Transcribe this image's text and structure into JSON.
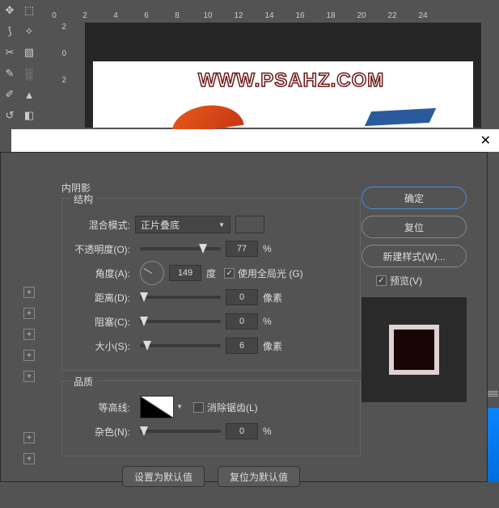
{
  "ruler_top": [
    "0",
    "2",
    "4",
    "6",
    "8",
    "10",
    "12",
    "14",
    "16",
    "18",
    "20",
    "22",
    "24"
  ],
  "ruler_left": [
    "2",
    "0",
    "2"
  ],
  "watermark": "WWW.PSAHZ.COM",
  "dialog": {
    "section_title": "内阴影",
    "structure_legend": "结构",
    "quality_legend": "品质",
    "blend_mode_label": "混合模式:",
    "blend_mode_value": "正片叠底",
    "blend_color": "#ff7a1a",
    "opacity_label": "不透明度(O):",
    "opacity_value": "77",
    "opacity_unit": "%",
    "angle_label": "角度(A):",
    "angle_value": "149",
    "angle_unit": "度",
    "global_light_label": "使用全局光 (G)",
    "distance_label": "距离(D):",
    "distance_value": "0",
    "distance_unit": "像素",
    "choke_label": "阻塞(C):",
    "choke_value": "0",
    "choke_unit": "%",
    "size_label": "大小(S):",
    "size_value": "6",
    "size_unit": "像素",
    "contour_label": "等高线:",
    "antialias_label": "消除锯齿(L)",
    "noise_label": "杂色(N):",
    "noise_value": "0",
    "noise_unit": "%",
    "set_default": "设置为默认值",
    "reset_default": "复位为默认值"
  },
  "right": {
    "ok": "确定",
    "cancel": "复位",
    "new_style": "新建样式(W)...",
    "preview": "预览(V)"
  }
}
